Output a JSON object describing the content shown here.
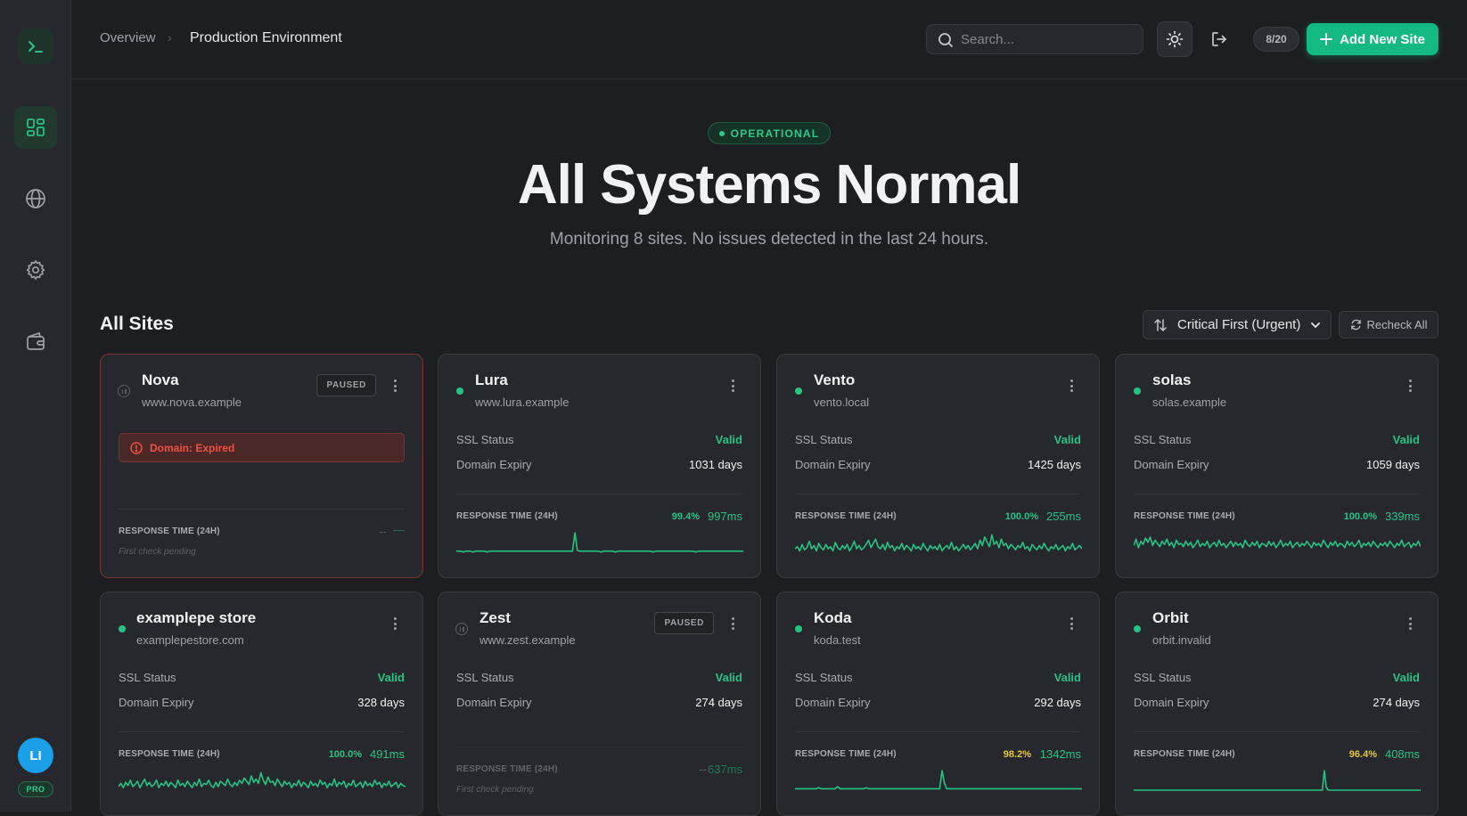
{
  "sidebar": {
    "logo_icon": "terminal-icon",
    "items": [
      {
        "icon": "dashboard-icon",
        "active": true
      },
      {
        "icon": "globe-icon",
        "active": false
      },
      {
        "icon": "gear-icon",
        "active": false
      },
      {
        "icon": "wallet-icon",
        "active": false
      }
    ],
    "avatar_initials": "LI",
    "plan_badge": "PRO"
  },
  "header": {
    "breadcrumb": [
      "Overview",
      "Production Environment"
    ],
    "search_placeholder": "Search...",
    "site_count": "8/20",
    "add_button": "Add New Site"
  },
  "hero": {
    "status": "OPERATIONAL",
    "title": "All Systems Normal",
    "subtitle": "Monitoring 8 sites. No issues detected in the last 24 hours."
  },
  "sites_section": {
    "title": "All Sites",
    "sort_label": "Critical First (Urgent)",
    "recheck_label": "Recheck All"
  },
  "labels": {
    "ssl": "SSL Status",
    "domain": "Domain Expiry",
    "response": "RESPONSE TIME (24H)",
    "pending": "First check pending",
    "paused": "PAUSED",
    "placeholder_dash": "--"
  },
  "colors": {
    "accent": "#14b981",
    "ok": "#25c384",
    "warn": "#e3c93a",
    "error": "#f0503e"
  },
  "sites": [
    {
      "name": "Nova",
      "url": "www.nova.example",
      "paused": true,
      "alert": "Domain: Expired",
      "ssl": "",
      "domain_expiry": "",
      "uptime": "--",
      "response": "—",
      "pending": true,
      "spark": []
    },
    {
      "name": "Lura",
      "url": "www.lura.example",
      "paused": false,
      "alert": "",
      "ssl": "Valid",
      "domain_expiry": "1031 days",
      "uptime": "99.4%",
      "uptime_status": "ok",
      "response": "997ms",
      "pending": false,
      "spark": [
        3,
        3,
        3,
        2,
        3,
        3,
        3,
        2,
        3,
        3,
        3,
        3,
        3,
        2,
        3,
        3,
        3,
        3,
        3,
        3,
        3,
        3,
        3,
        3,
        3,
        3,
        3,
        3,
        3,
        3,
        3,
        3,
        3,
        3,
        3,
        3,
        3,
        3,
        3,
        3,
        3,
        3,
        3,
        3,
        3,
        3,
        3,
        3,
        3,
        3,
        22,
        4,
        3,
        3,
        3,
        3,
        3,
        3,
        3,
        3,
        3,
        2,
        3,
        3,
        3,
        3,
        3,
        2,
        3,
        3,
        3,
        3,
        3,
        3,
        3,
        3,
        3,
        3,
        3,
        3,
        3,
        3,
        3,
        2,
        3,
        3,
        3,
        3,
        3,
        3,
        3,
        3,
        3,
        3,
        3,
        3,
        3,
        3,
        3,
        3,
        3,
        2,
        3,
        3,
        3,
        3,
        3,
        3,
        3,
        3,
        3,
        3,
        3,
        3,
        3,
        3,
        3,
        3,
        3,
        3,
        3,
        3
      ]
    },
    {
      "name": "Vento",
      "url": "vento.local",
      "paused": false,
      "alert": "",
      "ssl": "Valid",
      "domain_expiry": "1425 days",
      "uptime": "100.0%",
      "uptime_status": "ok",
      "response": "255ms",
      "pending": false,
      "spark": [
        5,
        7,
        3,
        9,
        4,
        6,
        12,
        5,
        8,
        3,
        10,
        6,
        4,
        9,
        5,
        7,
        3,
        11,
        6,
        4,
        8,
        5,
        9,
        3,
        7,
        12,
        5,
        8,
        4,
        6,
        9,
        13,
        6,
        10,
        14,
        7,
        5,
        9,
        4,
        11,
        6,
        8,
        3,
        7,
        5,
        10,
        4,
        8,
        6,
        3,
        9,
        5,
        7,
        4,
        10,
        6,
        3,
        8,
        5,
        7,
        4,
        9,
        3,
        6,
        8,
        5,
        11,
        4,
        7,
        3,
        6,
        9,
        5,
        8,
        4,
        7,
        10,
        5,
        13,
        8,
        16,
        11,
        7,
        18,
        9,
        12,
        6,
        14,
        8,
        10,
        5,
        9,
        7,
        4,
        8,
        6,
        11,
        5,
        7,
        3,
        9,
        6,
        4,
        8,
        5,
        10,
        6,
        3,
        7,
        5,
        9,
        4,
        6,
        8,
        3,
        7,
        5,
        10,
        4,
        6,
        8,
        5
      ]
    },
    {
      "name": "solas",
      "url": "solas.example",
      "paused": false,
      "alert": "",
      "ssl": "Valid",
      "domain_expiry": "1059 days",
      "uptime": "100.0%",
      "uptime_status": "ok",
      "response": "339ms",
      "pending": false,
      "spark": [
        8,
        14,
        6,
        12,
        9,
        15,
        11,
        16,
        8,
        13,
        10,
        7,
        12,
        9,
        14,
        8,
        11,
        6,
        13,
        9,
        10,
        7,
        12,
        8,
        11,
        6,
        9,
        13,
        7,
        10,
        8,
        12,
        6,
        9,
        11,
        7,
        13,
        8,
        10,
        6,
        9,
        12,
        7,
        11,
        8,
        10,
        6,
        13,
        9,
        7,
        11,
        8,
        12,
        6,
        10,
        9,
        7,
        12,
        8,
        11,
        6,
        9,
        13,
        7,
        10,
        8,
        12,
        6,
        9,
        11,
        7,
        10,
        8,
        12,
        9,
        6,
        11,
        8,
        10,
        7,
        13,
        9,
        6,
        11,
        8,
        12,
        7,
        10,
        9,
        6,
        12,
        8,
        11,
        7,
        9,
        13,
        6,
        10,
        8,
        11,
        7,
        12,
        9,
        6,
        10,
        8,
        11,
        7,
        12,
        9,
        6,
        10,
        8,
        13,
        7,
        9,
        11,
        6,
        10,
        8,
        12,
        7
      ]
    },
    {
      "name": "examplepe store",
      "url": "examplepestore.com",
      "paused": false,
      "alert": "",
      "ssl": "Valid",
      "domain_expiry": "328 days",
      "uptime": "100.0%",
      "uptime_status": "ok",
      "response": "491ms",
      "pending": false,
      "spark": [
        5,
        8,
        4,
        9,
        6,
        11,
        5,
        7,
        10,
        4,
        8,
        12,
        6,
        9,
        5,
        7,
        11,
        4,
        8,
        6,
        10,
        5,
        9,
        7,
        4,
        11,
        6,
        8,
        5,
        10,
        7,
        4,
        9,
        6,
        12,
        5,
        8,
        7,
        11,
        6,
        4,
        9,
        5,
        10,
        8,
        6,
        12,
        7,
        5,
        9,
        6,
        11,
        8,
        13,
        10,
        7,
        15,
        9,
        12,
        8,
        18,
        11,
        7,
        14,
        9,
        10,
        6,
        12,
        8,
        5,
        10,
        7,
        9,
        4,
        8,
        6,
        11,
        5,
        9,
        7,
        4,
        10,
        6,
        8,
        5,
        11,
        7,
        9,
        4,
        8,
        6,
        12,
        5,
        9,
        7,
        10,
        4,
        8,
        6,
        11,
        5,
        7,
        9,
        4,
        10,
        6,
        8,
        5,
        11,
        7,
        9,
        4,
        8,
        6,
        10,
        5,
        7,
        9,
        4,
        8,
        6,
        5
      ]
    },
    {
      "name": "Zest",
      "url": "www.zest.example",
      "paused": true,
      "alert": "",
      "ssl": "Valid",
      "domain_expiry": "274 days",
      "uptime": "--",
      "response": "637ms",
      "pending": true,
      "spark": []
    },
    {
      "name": "Koda",
      "url": "koda.test",
      "paused": false,
      "alert": "",
      "ssl": "Valid",
      "domain_expiry": "292 days",
      "uptime": "98.2%",
      "uptime_status": "warn",
      "response": "1342ms",
      "pending": false,
      "spark": [
        3,
        3,
        3,
        3,
        3,
        3,
        3,
        3,
        3,
        3,
        4,
        3,
        3,
        3,
        3,
        3,
        3,
        3,
        5,
        3,
        3,
        3,
        3,
        3,
        3,
        3,
        3,
        3,
        3,
        3,
        4,
        3,
        3,
        3,
        3,
        3,
        3,
        3,
        3,
        3,
        3,
        3,
        3,
        3,
        3,
        3,
        3,
        3,
        3,
        3,
        3,
        3,
        3,
        3,
        3,
        3,
        3,
        3,
        3,
        3,
        3,
        3,
        20,
        8,
        3,
        3,
        3,
        3,
        3,
        3,
        3,
        3,
        3,
        3,
        3,
        3,
        3,
        3,
        3,
        3,
        3,
        3,
        3,
        3,
        3,
        3,
        3,
        3,
        3,
        3,
        3,
        3,
        3,
        3,
        3,
        3,
        3,
        3,
        3,
        3,
        3,
        3,
        3,
        3,
        3,
        3,
        3,
        3,
        3,
        3,
        3,
        3,
        3,
        3,
        3,
        3,
        3,
        3,
        3,
        3,
        3,
        3
      ]
    },
    {
      "name": "Orbit",
      "url": "orbit.invalid",
      "paused": false,
      "alert": "",
      "ssl": "Valid",
      "domain_expiry": "274 days",
      "uptime": "96.4%",
      "uptime_status": "warn",
      "response": "408ms",
      "pending": false,
      "spark": [
        2,
        2,
        2,
        2,
        2,
        2,
        2,
        2,
        2,
        2,
        2,
        2,
        2,
        2,
        2,
        2,
        2,
        2,
        2,
        2,
        2,
        2,
        2,
        2,
        2,
        2,
        2,
        2,
        2,
        2,
        2,
        2,
        2,
        2,
        2,
        2,
        2,
        2,
        2,
        2,
        2,
        2,
        2,
        2,
        2,
        2,
        2,
        2,
        2,
        2,
        2,
        2,
        2,
        2,
        2,
        2,
        2,
        2,
        2,
        2,
        2,
        2,
        2,
        2,
        2,
        2,
        2,
        2,
        2,
        2,
        2,
        2,
        2,
        2,
        2,
        2,
        2,
        2,
        2,
        2,
        2,
        2,
        2,
        2,
        2,
        2,
        2,
        2,
        2,
        2,
        2,
        2,
        2,
        2,
        2,
        2,
        2,
        24,
        5,
        2,
        2,
        2,
        2,
        2,
        2,
        2,
        2,
        2,
        2,
        2,
        2,
        2,
        2,
        2,
        2,
        2,
        2,
        2,
        2,
        2,
        2,
        2,
        2,
        2,
        2,
        2,
        2,
        2,
        2,
        2,
        2,
        2,
        2,
        2,
        2,
        2,
        2,
        2,
        2,
        2,
        2,
        2,
        2,
        2,
        2,
        2,
        2
      ]
    }
  ]
}
